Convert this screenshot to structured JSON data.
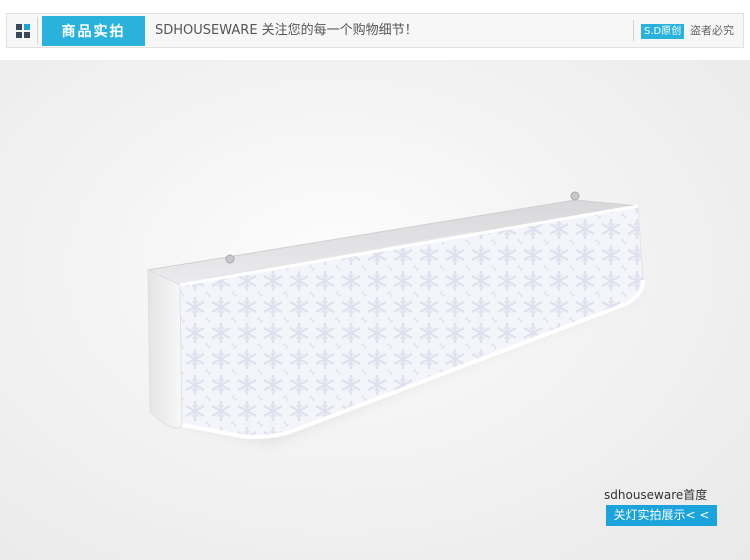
{
  "header": {
    "title": "商品实拍",
    "tagline": "SDHOUSEWARE  关注您的每一个购物细节！",
    "badge": "S.D原创",
    "warning": "盗者必究"
  },
  "icons": {
    "menu": "grid-icon"
  },
  "caption": {
    "brand": "sdhouseware首度",
    "button": "关灯实拍展示< <"
  },
  "colors": {
    "accent": "#29b3dc",
    "button": "#1ba3dc"
  }
}
